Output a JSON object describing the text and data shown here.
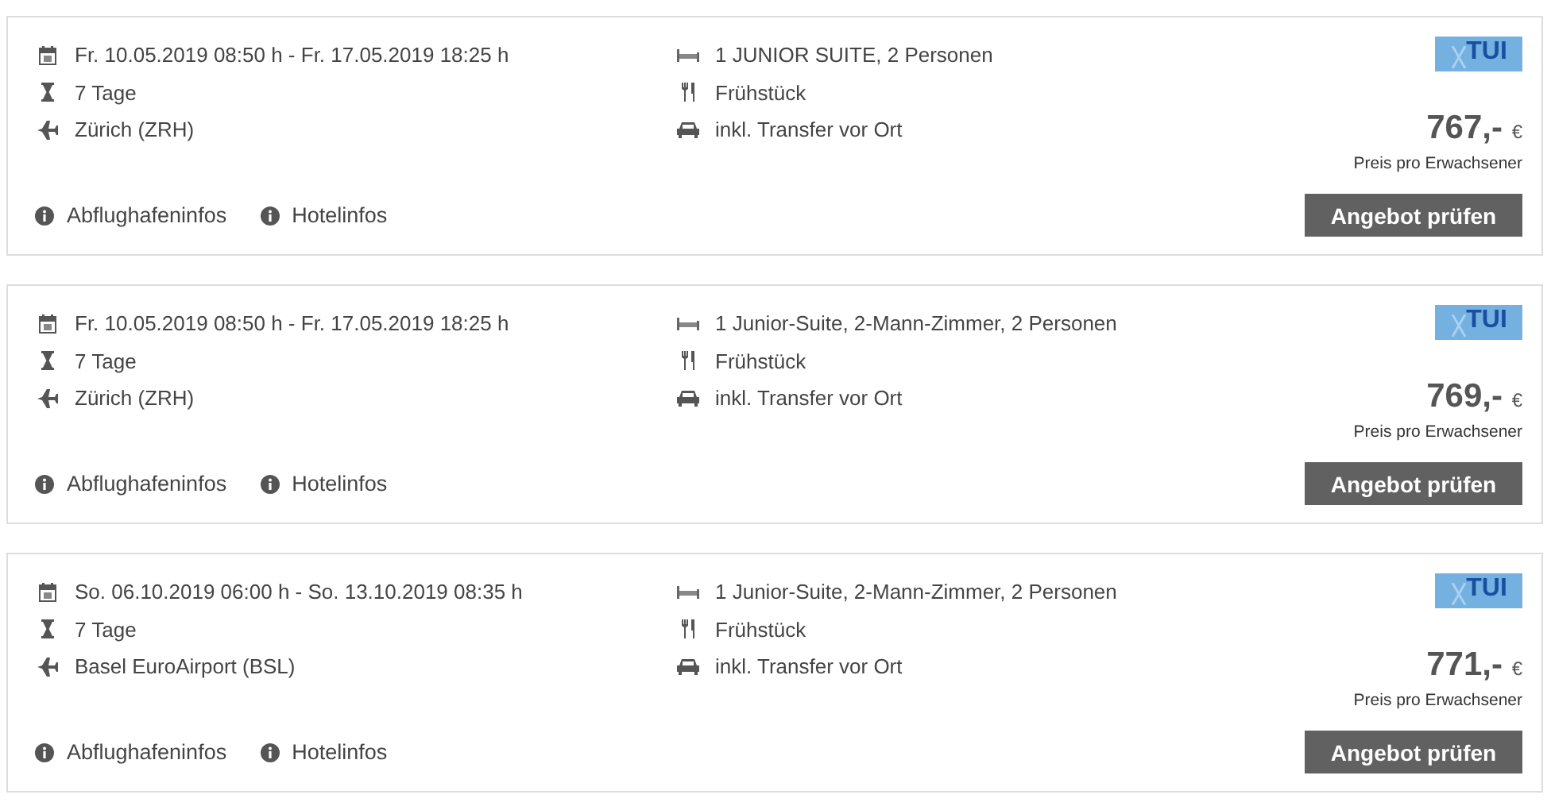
{
  "offers": [
    {
      "dates": "Fr. 10.05.2019 08:50 h - Fr. 17.05.2019 18:25 h",
      "duration": "7 Tage",
      "airport": "Zürich (ZRH)",
      "room": "1 JUNIOR SUITE, 2 Personen",
      "board": "Frühstück",
      "transfer": "inkl. Transfer vor Ort",
      "logo": {
        "name": "TUI"
      },
      "price": "767,-",
      "currency": "€",
      "price_note": "Preis pro Erwachsener",
      "links": [
        "Abflughafeninfos",
        "Hotelinfos"
      ],
      "button": "Angebot prüfen"
    },
    {
      "dates": "Fr. 10.05.2019 08:50 h - Fr. 17.05.2019 18:25 h",
      "duration": "7 Tage",
      "airport": "Zürich (ZRH)",
      "room": "1 Junior-Suite, 2-Mann-Zimmer, 2 Personen",
      "board": "Frühstück",
      "transfer": "inkl. Transfer vor Ort",
      "logo": {
        "name": "TUI"
      },
      "price": "769,-",
      "currency": "€",
      "price_note": "Preis pro Erwachsener",
      "links": [
        "Abflughafeninfos",
        "Hotelinfos"
      ],
      "button": "Angebot prüfen"
    },
    {
      "dates": "So. 06.10.2019 06:00 h - So. 13.10.2019 08:35 h",
      "duration": "7 Tage",
      "airport": "Basel EuroAirport (BSL)",
      "room": "1 Junior-Suite, 2-Mann-Zimmer, 2 Personen",
      "board": "Frühstück",
      "transfer": "inkl. Transfer vor Ort",
      "logo": {
        "name": "TUI"
      },
      "price": "771,-",
      "currency": "€",
      "price_note": "Preis pro Erwachsener",
      "links": [
        "Abflughafeninfos",
        "Hotelinfos"
      ],
      "button": "Angebot prüfen"
    }
  ]
}
